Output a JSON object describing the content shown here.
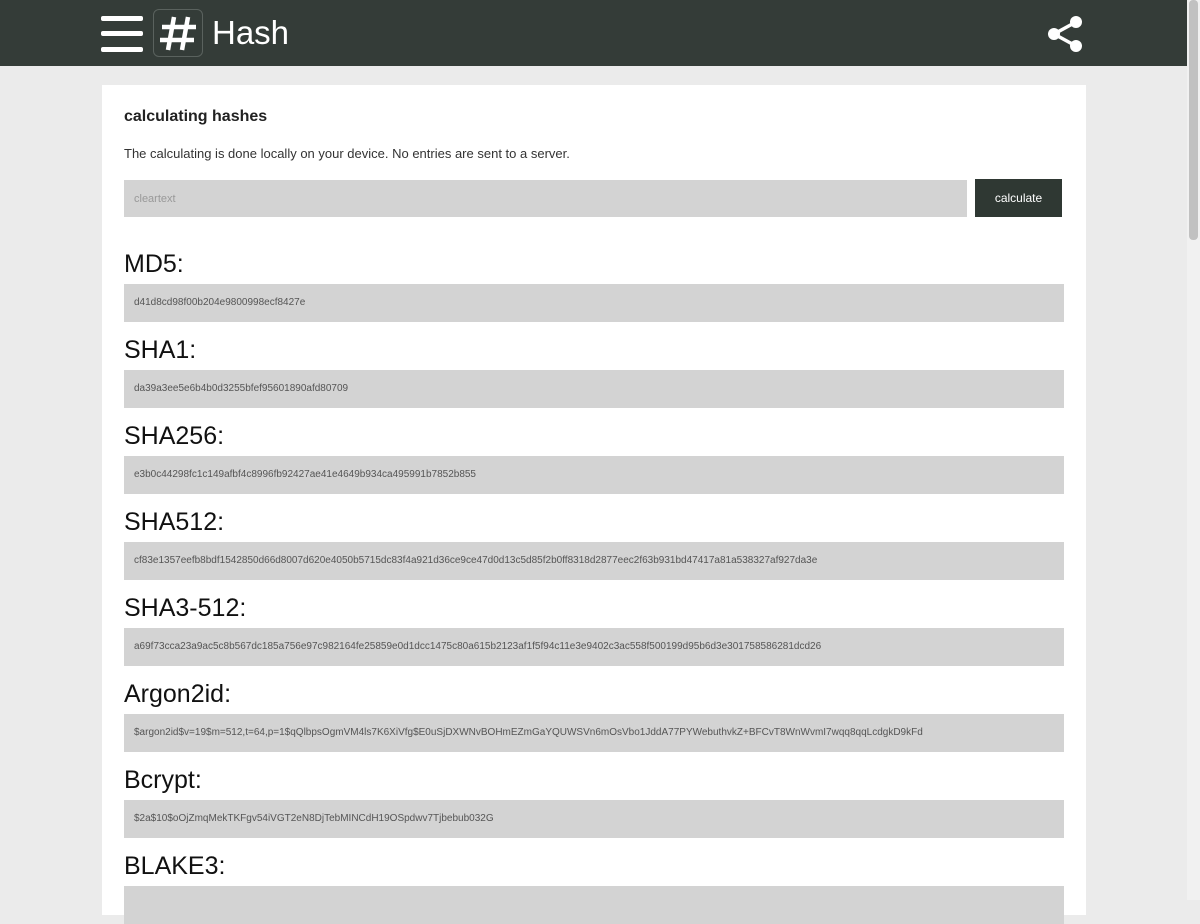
{
  "header": {
    "menu_icon": "hamburger-menu-icon",
    "logo_icon": "hash-symbol-icon",
    "logo_symbol": "#",
    "title": "Hash",
    "share_icon": "share-icon",
    "background": "#343c38"
  },
  "card": {
    "title": "calculating hashes",
    "description": "The calculating is done locally on your device. No entries are sent to a server.",
    "input": {
      "placeholder": "cleartext",
      "value": ""
    },
    "calculate_label": "calculate",
    "hashes": [
      {
        "label": "MD5:",
        "value": "d41d8cd98f00b204e9800998ecf8427e"
      },
      {
        "label": "SHA1:",
        "value": "da39a3ee5e6b4b0d3255bfef95601890afd80709"
      },
      {
        "label": "SHA256:",
        "value": "e3b0c44298fc1c149afbf4c8996fb92427ae41e4649b934ca495991b7852b855"
      },
      {
        "label": "SHA512:",
        "value": "cf83e1357eefb8bdf1542850d66d8007d620e4050b5715dc83f4a921d36ce9ce47d0d13c5d85f2b0ff8318d2877eec2f63b931bd47417a81a538327af927da3e"
      },
      {
        "label": "SHA3-512:",
        "value": "a69f73cca23a9ac5c8b567dc185a756e97c982164fe25859e0d1dcc1475c80a615b2123af1f5f94c11e3e9402c3ac558f500199d95b6d3e301758586281dcd26"
      },
      {
        "label": "Argon2id:",
        "value": "$argon2id$v=19$m=512,t=64,p=1$qQlbpsOgmVM4ls7K6XiVfg$E0uSjDXWNvBOHmEZmGaYQUWSVn6mOsVbo1JddA77PYWebuthvkZ+BFCvT8WnWvmI7wqq8qqLcdgkD9kFd"
      },
      {
        "label": "Bcrypt:",
        "value": "$2a$10$oOjZmqMekTKFgv54iVGT2eN8DjTebMINCdH19OSpdwv7Tjbebub032G"
      },
      {
        "label": "BLAKE3:",
        "value": ""
      }
    ]
  }
}
